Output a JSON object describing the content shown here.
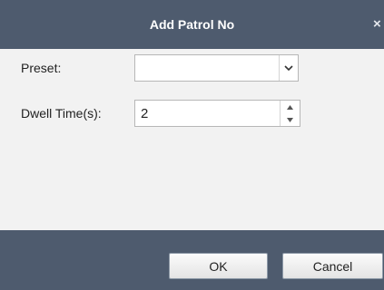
{
  "dialog": {
    "title": "Add Patrol No",
    "close_icon": "close-icon",
    "close_glyph": "×"
  },
  "form": {
    "preset": {
      "label": "Preset:",
      "value": "",
      "dropdown_icon": "chevron-down-icon"
    },
    "dwell_time": {
      "label": "Dwell Time(s):",
      "value": "2",
      "up_icon": "chevron-up-icon",
      "down_icon": "chevron-down-icon"
    }
  },
  "footer": {
    "ok_label": "OK",
    "cancel_label": "Cancel"
  },
  "colors": {
    "titlebar": "#4e5b6e",
    "body_bg": "#f2f2f2",
    "footer": "#4e5b6e"
  }
}
